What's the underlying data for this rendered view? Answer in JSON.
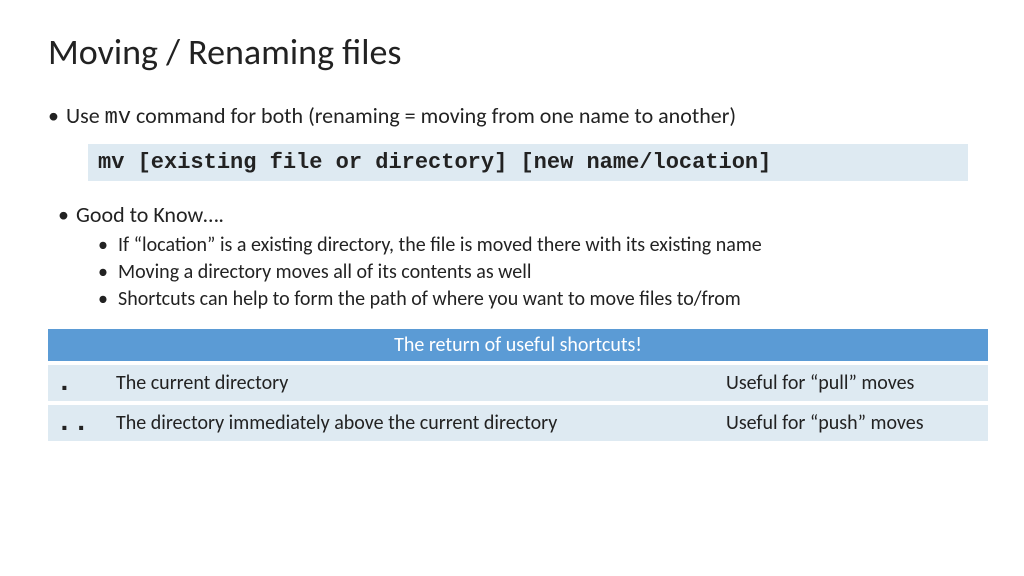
{
  "title": "Moving / Renaming files",
  "line1_pre": "Use ",
  "line1_mono": "mv",
  "line1_post": " command for both (renaming = moving from one name to another)",
  "codebox": "mv [existing file or directory] [new name/location]",
  "gtk_heading": "Good to Know….",
  "gtk_items": [
    "If “location” is a existing directory, the file is moved there with its existing name",
    "Moving a directory moves all of its contents as well",
    "Shortcuts can help to form the path of where you want to move files to/from"
  ],
  "table": {
    "header": "The return of useful shortcuts!",
    "rows": [
      {
        "sym": ".",
        "desc": "The current directory",
        "note": "Useful for “pull” moves"
      },
      {
        "sym": "..",
        "desc": "The directory immediately above the current directory",
        "note": "Useful for “push” moves"
      }
    ]
  }
}
